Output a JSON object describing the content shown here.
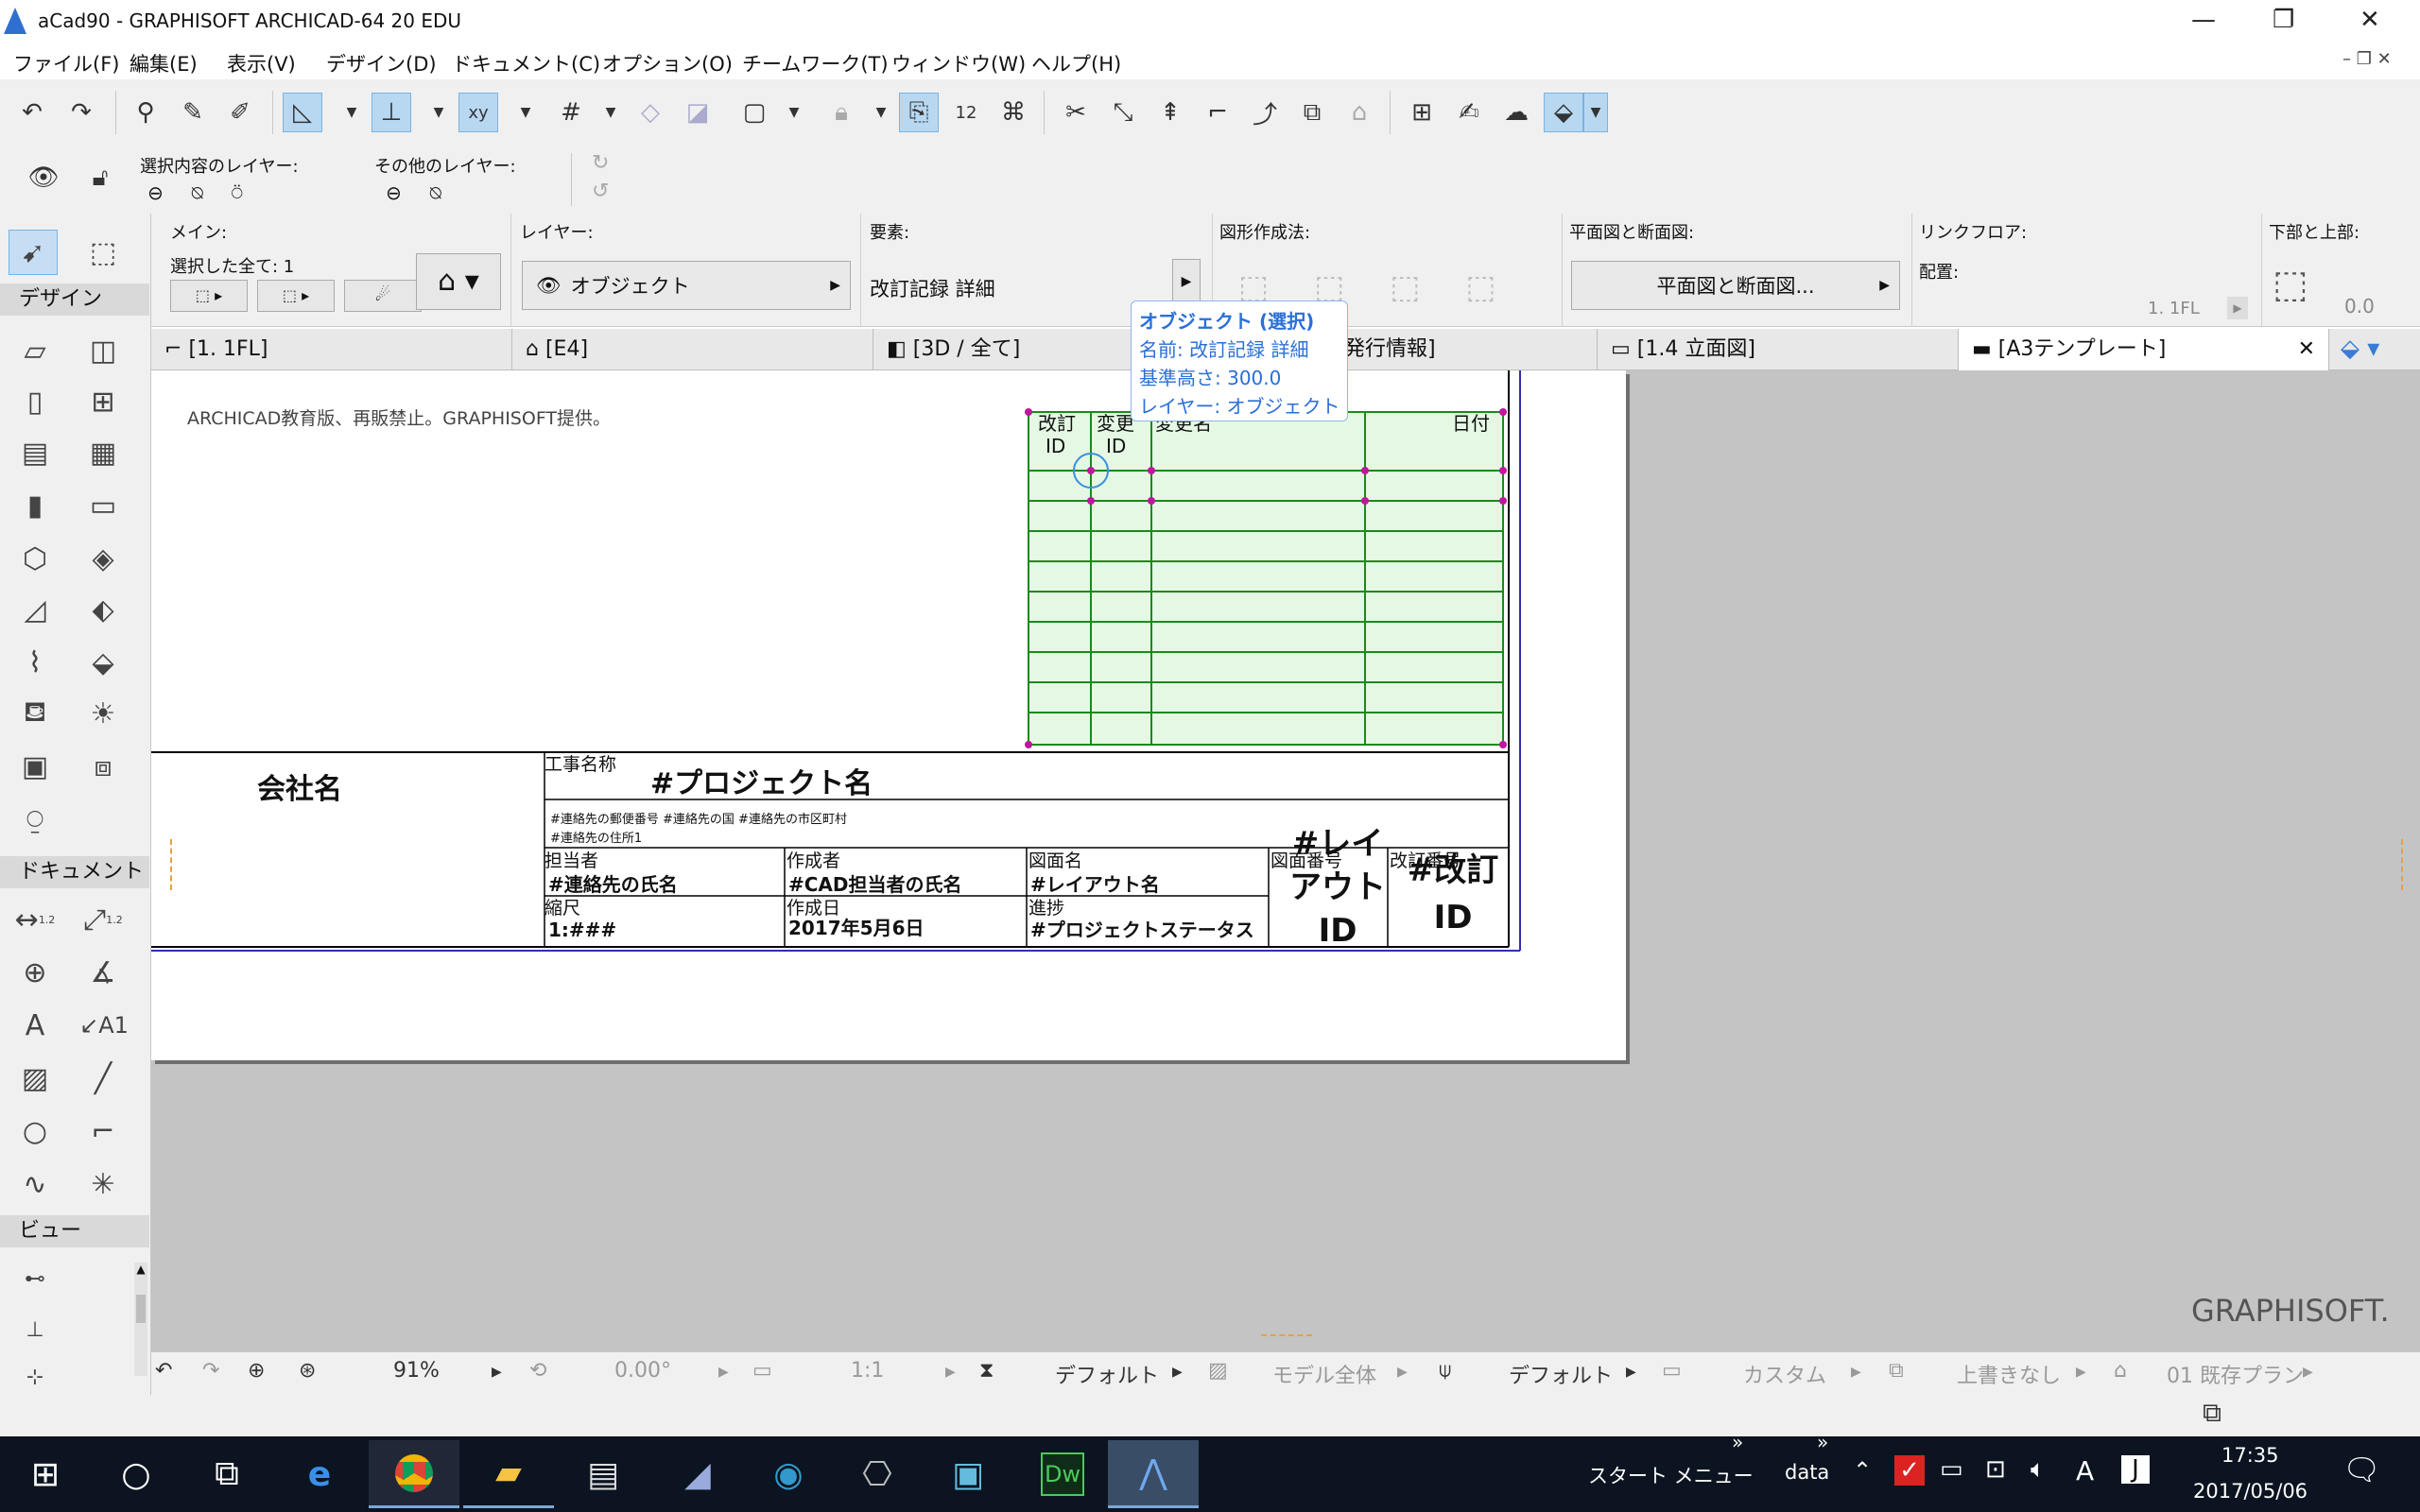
{
  "window": {
    "title": "aCad90 - GRAPHISOFT ARCHICAD-64 20 EDU"
  },
  "menu": [
    "ファイル(F)",
    "編集(E)",
    "表示(V)",
    "デザイン(D)",
    "ドキュメント(C)",
    "オプション(O)",
    "チームワーク(T)",
    "ウィンドウ(W)",
    "ヘルプ(H)"
  ],
  "layers": {
    "selected_label": "選択内容のレイヤー:",
    "other_label": "その他のレイヤー:"
  },
  "infobox": {
    "main_label": "メイン:",
    "selection_label": "選択した全て: 1",
    "layer_label": "レイヤー:",
    "layer_value": "オブジェクト",
    "element_label": "要素:",
    "element_value": "改訂記録 詳細",
    "geometry_label": "図形作成法:",
    "plan_section_label": "平面図と断面図:",
    "plan_section_button": "平面図と断面図...",
    "link_floor_label": "リンクフロア:",
    "placement_label": "配置:",
    "floor_value": "1. 1FL",
    "top_bottom_label": "下部と上部:",
    "offset_value": "0.0"
  },
  "tabs": [
    "[1. 1FL]",
    "[E4]",
    "[3D / 全て]",
    "発行情報]",
    "[1.4 立面図]",
    "[A3テンプレート]"
  ],
  "toolbox": {
    "design_header": "デザイン",
    "document_header": "ドキュメント",
    "view_header": "ビュー",
    "dim1": "1.2",
    "dim2": "1.2",
    "text_tool": "A",
    "label_tool": "A1"
  },
  "tooltip": {
    "title": "オブジェクト (選択)",
    "name": "名前: 改訂記録 詳細",
    "height": "基準高さ: 300.0",
    "layer": "レイヤー: オブジェクト"
  },
  "sheet": {
    "edu_note": "ARCHICAD教育版、再販禁止。GRAPHISOFT提供。",
    "rev_col1_a": "改訂",
    "rev_col1_b": "ID",
    "rev_col2_a": "変更",
    "rev_col2_b": "ID",
    "rev_col3": "変更名",
    "rev_col4": "日付",
    "company": "会社名",
    "project_label": "工事名称",
    "project_value": "#プロジェクト名",
    "address_line1": "#連絡先の郵便番号 #連絡先の国 #連絡先の市区町村",
    "address_line2": "#連絡先の住所1",
    "manager_label": "担当者",
    "manager_value": "#連絡先の氏名",
    "author_label": "作成者",
    "author_value": "#CAD担当者の氏名",
    "drawing_label": "図面名",
    "drawing_value": "#レイアウト名",
    "number_label": "図面番号",
    "number_value": "#レイアウトID",
    "revision_label": "改訂番号",
    "revision_value": "#改訂ID",
    "scale_label": "縮尺",
    "scale_value": "1:###",
    "date_label": "作成日",
    "date_value": "2017年5月6日",
    "progress_label": "進捗",
    "progress_value": "#プロジェクトステータス"
  },
  "watermark": "GRAPHISOFT.",
  "status": {
    "zoom": "91%",
    "angle": "0.00°",
    "scale": "1:1",
    "pen_set": "デフォルト",
    "model": "モデル全体",
    "dimension": "デフォルト",
    "custom": "カスタム",
    "override": "上書きなし",
    "renovation": "01 既存プラン"
  },
  "taskbar": {
    "start_menu": "スタート メニュー",
    "data": "data",
    "time": "17:35",
    "date": "2017/05/06",
    "dw": "Dw"
  }
}
